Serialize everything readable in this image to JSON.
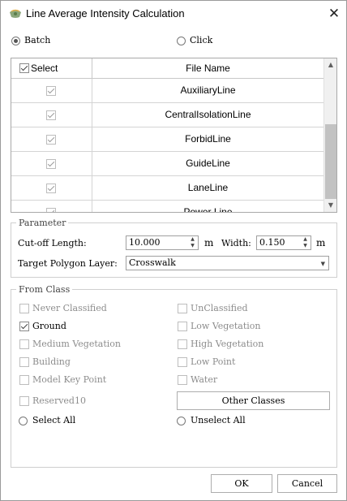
{
  "window": {
    "title": "Line Average Intensity Calculation",
    "close_symbol": "✕",
    "icon": "app-logo-icon"
  },
  "mode": {
    "options": [
      {
        "label": "Batch",
        "selected": true
      },
      {
        "label": "Click",
        "selected": false
      }
    ]
  },
  "table": {
    "header_select": "Select",
    "header_name": "File Name",
    "rows": [
      {
        "name": "AuxiliaryLine",
        "checked": true
      },
      {
        "name": "CentralIsolationLine",
        "checked": true
      },
      {
        "name": "ForbidLine",
        "checked": true
      },
      {
        "name": "GuideLine",
        "checked": true
      },
      {
        "name": "LaneLine",
        "checked": true
      },
      {
        "name": "Power Line",
        "checked": true
      }
    ],
    "scroll_up": "▲",
    "scroll_down": "▼"
  },
  "parameter": {
    "title": "Parameter",
    "cutoff_label": "Cut-off Length:",
    "cutoff_value": "10.000",
    "cutoff_unit": "m",
    "width_label": "Width:",
    "width_value": "0.150",
    "width_unit": "m",
    "polygon_label": "Target Polygon Layer:",
    "polygon_value": "Crosswalk",
    "spin_up": "▲",
    "spin_down": "▼",
    "combo_arrow": "▼"
  },
  "from_class": {
    "title": "From Class",
    "classes": [
      {
        "label": "Never Classified",
        "checked": false,
        "enabled": false
      },
      {
        "label": "UnClassified",
        "checked": false,
        "enabled": false
      },
      {
        "label": "Ground",
        "checked": true,
        "enabled": true
      },
      {
        "label": "Low Vegetation",
        "checked": false,
        "enabled": false
      },
      {
        "label": "Medium Vegetation",
        "checked": false,
        "enabled": false
      },
      {
        "label": "High Vegetation",
        "checked": false,
        "enabled": false
      },
      {
        "label": "Building",
        "checked": false,
        "enabled": false
      },
      {
        "label": "Low Point",
        "checked": false,
        "enabled": false
      },
      {
        "label": "Model Key Point",
        "checked": false,
        "enabled": false
      },
      {
        "label": "Water",
        "checked": false,
        "enabled": false
      },
      {
        "label": "Reserved10",
        "checked": false,
        "enabled": false
      }
    ],
    "other_classes_button": "Other Classes",
    "select_all_label": "Select All",
    "unselect_all_label": "Unselect All"
  },
  "footer": {
    "ok_label": "OK",
    "cancel_label": "Cancel"
  }
}
